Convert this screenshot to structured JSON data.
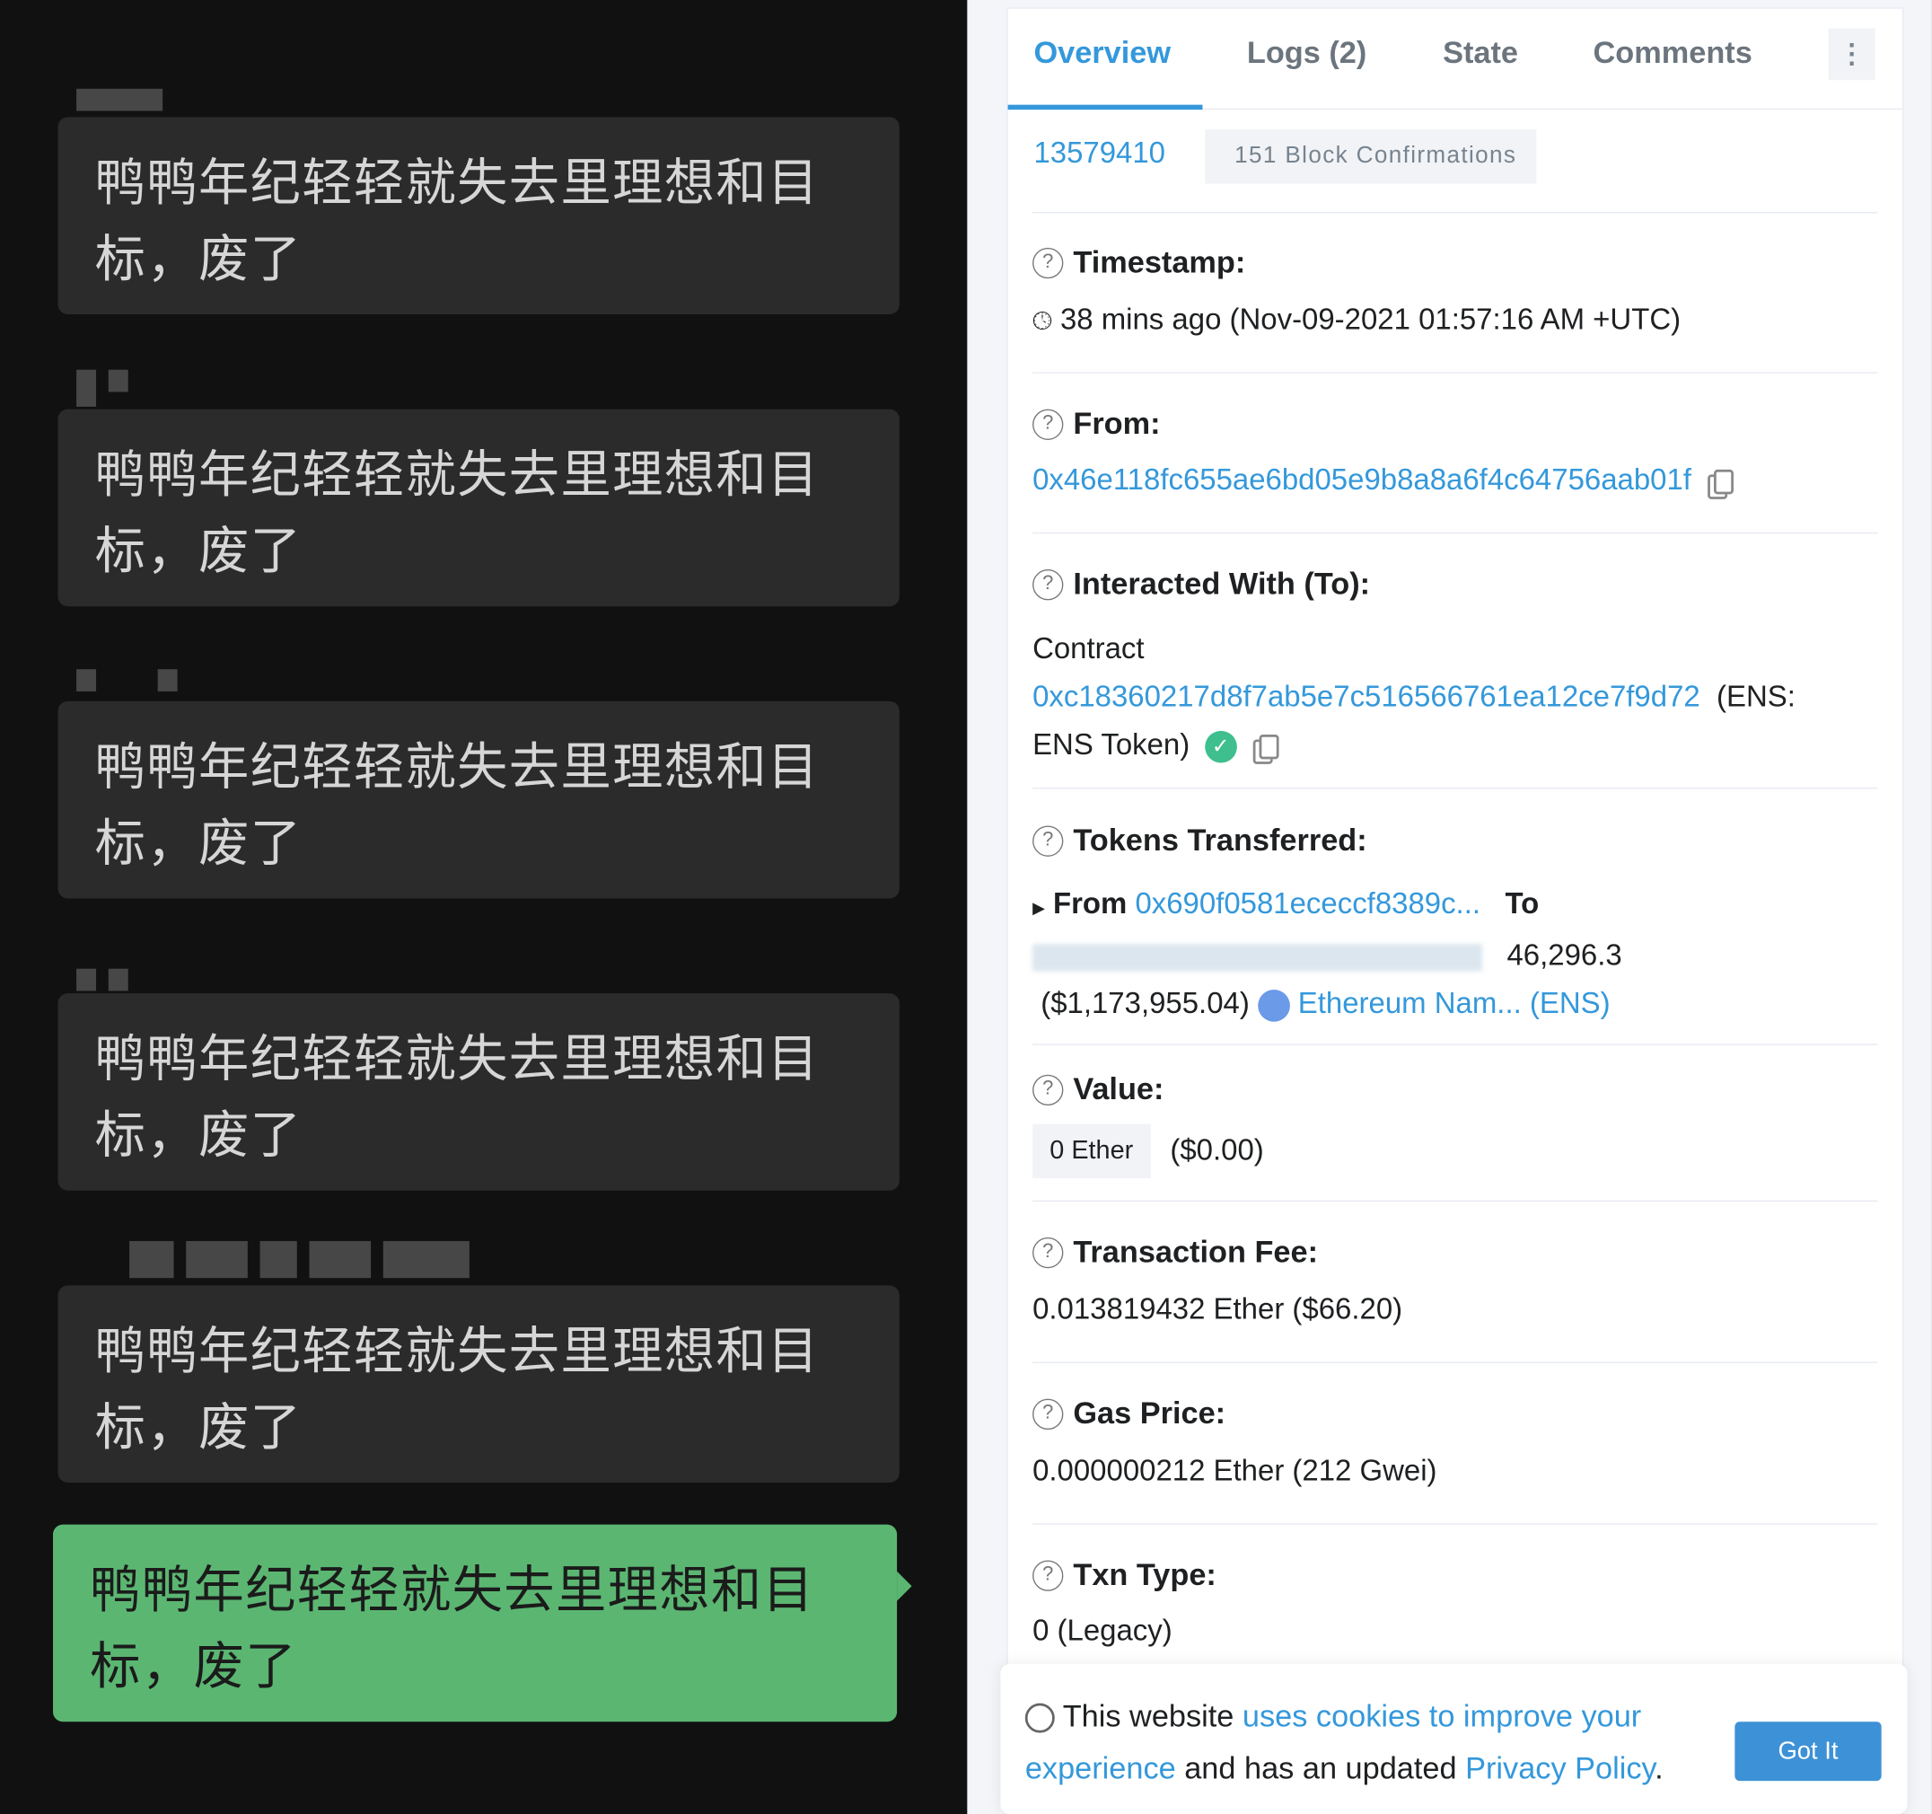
{
  "chat": {
    "messages": [
      {
        "text": "鸭鸭年纪轻轻就失去里理想和目标，废了",
        "mine": false
      },
      {
        "text": "鸭鸭年纪轻轻就失去里理想和目标，废了",
        "mine": false
      },
      {
        "text": "鸭鸭年纪轻轻就失去里理想和目标，废了",
        "mine": false
      },
      {
        "text": "鸭鸭年纪轻轻就失去里理想和目标，废了",
        "mine": false
      },
      {
        "text": "鸭鸭年纪轻轻就失去里理想和目标，废了",
        "mine": false
      },
      {
        "text": "鸭鸭年纪轻轻就失去里理想和目标，废了",
        "mine": true
      }
    ],
    "colors": {
      "bubble": "#2b2b2c",
      "mine": "#5bb672"
    }
  },
  "tabs": [
    "Overview",
    "Logs (2)",
    "State",
    "Comments"
  ],
  "block": {
    "number": "13579410",
    "confirmations": "151 Block Confirmations"
  },
  "timestamp": {
    "label": "Timestamp:",
    "value": "38 mins ago (Nov-09-2021 01:57:16 AM +UTC)"
  },
  "from": {
    "label": "From:",
    "address": "0x46e118fc655ae6bd05e9b8a8a6f4c64756aab01f"
  },
  "to": {
    "label": "Interacted With (To):",
    "prefix": "Contract",
    "address": "0xc18360217d8f7ab5e7c516566761ea12ce7f9d72",
    "ens_a": "(ENS:",
    "ens_b": "ENS Token)"
  },
  "tokens": {
    "label": "Tokens Transferred:",
    "from_word": "From",
    "from_addr": "0x690f0581ececcf8389c...",
    "to_word": "To",
    "amount": "46,296.3",
    "usd": "($1,173,955.04)",
    "token": "Ethereum Nam... (ENS)"
  },
  "value": {
    "label": "Value:",
    "ether": "0 Ether",
    "usd": "($0.00)"
  },
  "fee": {
    "label": "Transaction Fee:",
    "value": "0.013819432 Ether ($66.20)"
  },
  "gas": {
    "label": "Gas Price:",
    "value": "0.000000212 Ether (212 Gwei)"
  },
  "txntype": {
    "label": "Txn Type:",
    "value": "0 (Legacy)"
  },
  "cookie": {
    "t1": "This website ",
    "l1": "uses cookies to improve your",
    "l2": "experience",
    "t2": " and has an updated ",
    "l3": "Privacy Policy",
    "t3": ".",
    "button": "Got It"
  },
  "accent": "#3498db"
}
